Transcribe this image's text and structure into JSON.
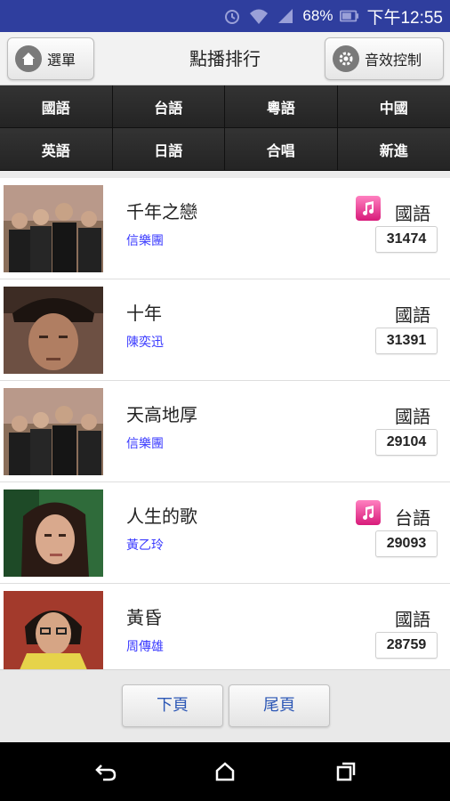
{
  "status_bar": {
    "battery_percent": "68%",
    "time": "下午12:55",
    "icons": [
      "alarm-icon",
      "wifi-icon",
      "signal-icon",
      "battery-icon"
    ]
  },
  "header": {
    "menu_label": "選單",
    "title": "點播排行",
    "sound_label": "音效控制"
  },
  "categories": [
    "國語",
    "台語",
    "粵語",
    "中國",
    "英語",
    "日語",
    "合唱",
    "新進"
  ],
  "songs": [
    {
      "title": "千年之戀",
      "artist": "信樂團",
      "language": "國語",
      "count": "31474",
      "has_note": true
    },
    {
      "title": "十年",
      "artist": "陳奕迅",
      "language": "國語",
      "count": "31391",
      "has_note": false
    },
    {
      "title": "天高地厚",
      "artist": "信樂團",
      "language": "國語",
      "count": "29104",
      "has_note": false
    },
    {
      "title": "人生的歌",
      "artist": "黃乙玲",
      "language": "台語",
      "count": "29093",
      "has_note": true
    },
    {
      "title": "黃昏",
      "artist": "周傳雄",
      "language": "國語",
      "count": "28759",
      "has_note": false
    }
  ],
  "pager": {
    "next_label": "下頁",
    "last_label": "尾頁"
  },
  "colors": {
    "status_bar": "#2f3e9e",
    "category_bg": "#2b2b2b",
    "artist_link": "#3a3aff",
    "note_badge": "#e0288a"
  }
}
